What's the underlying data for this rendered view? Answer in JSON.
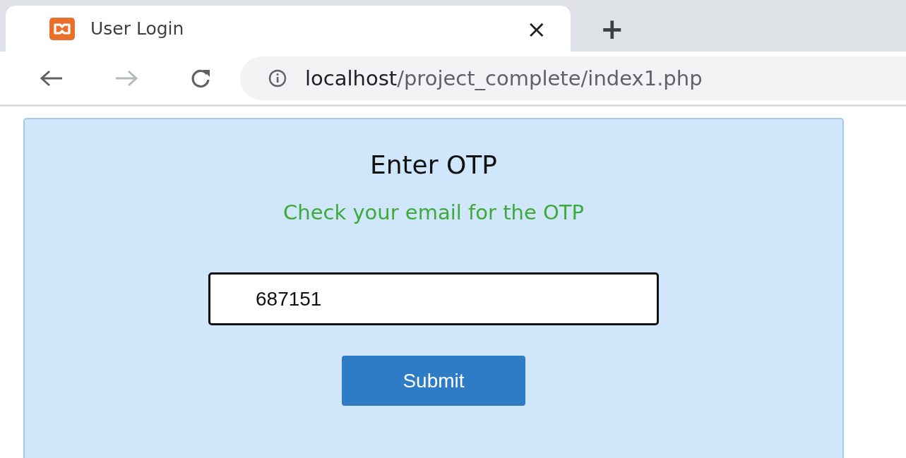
{
  "browser": {
    "tab": {
      "title": "User Login",
      "close": "×",
      "selected": true
    },
    "new_tab": "+",
    "address": {
      "host": "localhost",
      "path": "/project_complete/index1.php"
    }
  },
  "form": {
    "title": "Enter OTP",
    "message": "Check your email for the OTP",
    "otp_value": "687151",
    "submit": "Submit"
  }
}
